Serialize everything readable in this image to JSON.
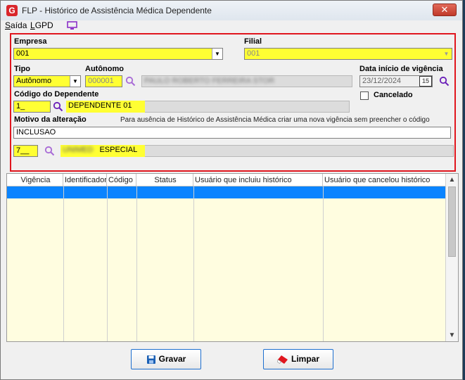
{
  "window": {
    "title": "FLP - Histórico de Assistência Médica Dependente"
  },
  "menu": {
    "saida": "Saída",
    "lgpd": "LGPD"
  },
  "form": {
    "empresa_label": "Empresa",
    "empresa_value": "001",
    "filial_label": "Filial",
    "filial_value": "001",
    "tipo_label": "Tipo",
    "tipo_value": "Autônomo",
    "autonomo_label": "Autônomo",
    "autonomo_code": "000001",
    "autonomo_name": "PAULO ROBERTO FERREIRA STOR",
    "data_label": "Data início de vigência",
    "data_value": "23/12/2024",
    "calendar_label": "15",
    "dependente_label": "Código do Dependente",
    "dependente_code": "1_",
    "dependente_name": "DEPENDENTE 01",
    "cancelado_label": "Cancelado",
    "motivo_label": "Motivo da alteração",
    "motivo_hint": "Para ausência de Histórico de Assistência Médica criar uma nova vigência sem preencher o código",
    "motivo_value": "INCLUSAO",
    "plano_code": "7__",
    "plano_name_blurred": "UNIMED",
    "plano_name": "ESPECIAL"
  },
  "grid": {
    "columns": [
      "Vigência",
      "Identificador",
      "Código",
      "Status",
      "Usuário que incluiu histórico",
      "Usuário que cancelou histórico"
    ]
  },
  "buttons": {
    "gravar": "Gravar",
    "limpar": "Limpar"
  },
  "colors": {
    "highlight": "#ffff33",
    "frame": "#e0161e",
    "selection": "#0a84ff",
    "button_border": "#1e6fcf"
  }
}
